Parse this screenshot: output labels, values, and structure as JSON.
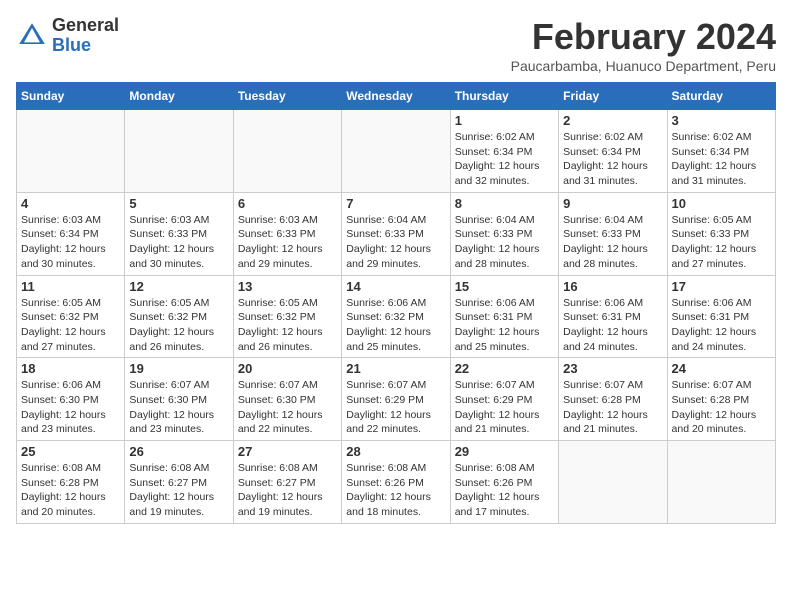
{
  "logo": {
    "general": "General",
    "blue": "Blue"
  },
  "title": "February 2024",
  "location": "Paucarbamba, Huanuco Department, Peru",
  "days_of_week": [
    "Sunday",
    "Monday",
    "Tuesday",
    "Wednesday",
    "Thursday",
    "Friday",
    "Saturday"
  ],
  "weeks": [
    [
      {
        "day": "",
        "info": ""
      },
      {
        "day": "",
        "info": ""
      },
      {
        "day": "",
        "info": ""
      },
      {
        "day": "",
        "info": ""
      },
      {
        "day": "1",
        "info": "Sunrise: 6:02 AM\nSunset: 6:34 PM\nDaylight: 12 hours and 32 minutes."
      },
      {
        "day": "2",
        "info": "Sunrise: 6:02 AM\nSunset: 6:34 PM\nDaylight: 12 hours and 31 minutes."
      },
      {
        "day": "3",
        "info": "Sunrise: 6:02 AM\nSunset: 6:34 PM\nDaylight: 12 hours and 31 minutes."
      }
    ],
    [
      {
        "day": "4",
        "info": "Sunrise: 6:03 AM\nSunset: 6:34 PM\nDaylight: 12 hours and 30 minutes."
      },
      {
        "day": "5",
        "info": "Sunrise: 6:03 AM\nSunset: 6:33 PM\nDaylight: 12 hours and 30 minutes."
      },
      {
        "day": "6",
        "info": "Sunrise: 6:03 AM\nSunset: 6:33 PM\nDaylight: 12 hours and 29 minutes."
      },
      {
        "day": "7",
        "info": "Sunrise: 6:04 AM\nSunset: 6:33 PM\nDaylight: 12 hours and 29 minutes."
      },
      {
        "day": "8",
        "info": "Sunrise: 6:04 AM\nSunset: 6:33 PM\nDaylight: 12 hours and 28 minutes."
      },
      {
        "day": "9",
        "info": "Sunrise: 6:04 AM\nSunset: 6:33 PM\nDaylight: 12 hours and 28 minutes."
      },
      {
        "day": "10",
        "info": "Sunrise: 6:05 AM\nSunset: 6:33 PM\nDaylight: 12 hours and 27 minutes."
      }
    ],
    [
      {
        "day": "11",
        "info": "Sunrise: 6:05 AM\nSunset: 6:32 PM\nDaylight: 12 hours and 27 minutes."
      },
      {
        "day": "12",
        "info": "Sunrise: 6:05 AM\nSunset: 6:32 PM\nDaylight: 12 hours and 26 minutes."
      },
      {
        "day": "13",
        "info": "Sunrise: 6:05 AM\nSunset: 6:32 PM\nDaylight: 12 hours and 26 minutes."
      },
      {
        "day": "14",
        "info": "Sunrise: 6:06 AM\nSunset: 6:32 PM\nDaylight: 12 hours and 25 minutes."
      },
      {
        "day": "15",
        "info": "Sunrise: 6:06 AM\nSunset: 6:31 PM\nDaylight: 12 hours and 25 minutes."
      },
      {
        "day": "16",
        "info": "Sunrise: 6:06 AM\nSunset: 6:31 PM\nDaylight: 12 hours and 24 minutes."
      },
      {
        "day": "17",
        "info": "Sunrise: 6:06 AM\nSunset: 6:31 PM\nDaylight: 12 hours and 24 minutes."
      }
    ],
    [
      {
        "day": "18",
        "info": "Sunrise: 6:06 AM\nSunset: 6:30 PM\nDaylight: 12 hours and 23 minutes."
      },
      {
        "day": "19",
        "info": "Sunrise: 6:07 AM\nSunset: 6:30 PM\nDaylight: 12 hours and 23 minutes."
      },
      {
        "day": "20",
        "info": "Sunrise: 6:07 AM\nSunset: 6:30 PM\nDaylight: 12 hours and 22 minutes."
      },
      {
        "day": "21",
        "info": "Sunrise: 6:07 AM\nSunset: 6:29 PM\nDaylight: 12 hours and 22 minutes."
      },
      {
        "day": "22",
        "info": "Sunrise: 6:07 AM\nSunset: 6:29 PM\nDaylight: 12 hours and 21 minutes."
      },
      {
        "day": "23",
        "info": "Sunrise: 6:07 AM\nSunset: 6:28 PM\nDaylight: 12 hours and 21 minutes."
      },
      {
        "day": "24",
        "info": "Sunrise: 6:07 AM\nSunset: 6:28 PM\nDaylight: 12 hours and 20 minutes."
      }
    ],
    [
      {
        "day": "25",
        "info": "Sunrise: 6:08 AM\nSunset: 6:28 PM\nDaylight: 12 hours and 20 minutes."
      },
      {
        "day": "26",
        "info": "Sunrise: 6:08 AM\nSunset: 6:27 PM\nDaylight: 12 hours and 19 minutes."
      },
      {
        "day": "27",
        "info": "Sunrise: 6:08 AM\nSunset: 6:27 PM\nDaylight: 12 hours and 19 minutes."
      },
      {
        "day": "28",
        "info": "Sunrise: 6:08 AM\nSunset: 6:26 PM\nDaylight: 12 hours and 18 minutes."
      },
      {
        "day": "29",
        "info": "Sunrise: 6:08 AM\nSunset: 6:26 PM\nDaylight: 12 hours and 17 minutes."
      },
      {
        "day": "",
        "info": ""
      },
      {
        "day": "",
        "info": ""
      }
    ]
  ]
}
